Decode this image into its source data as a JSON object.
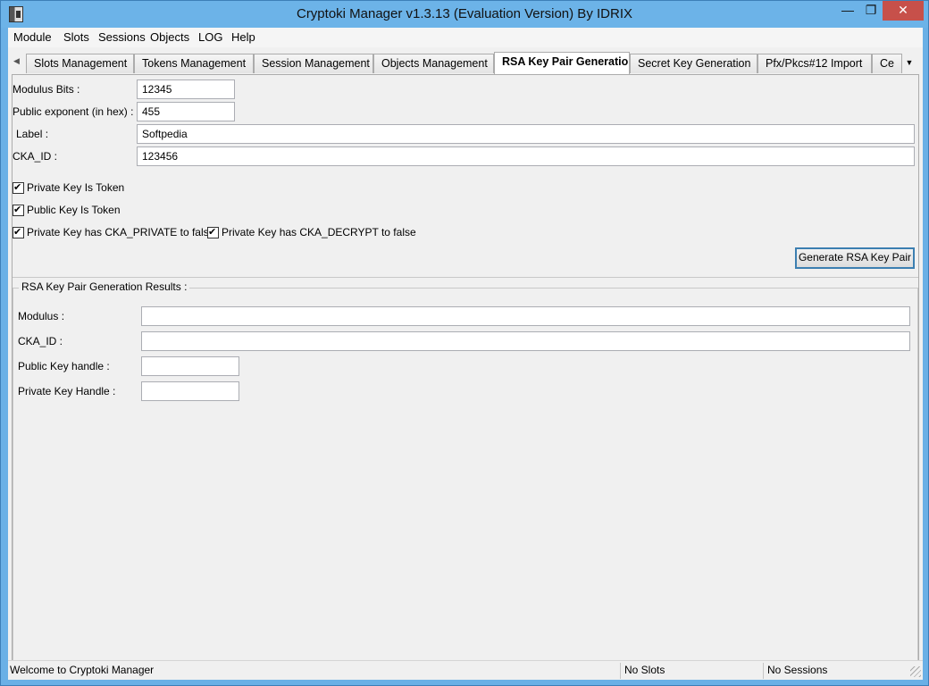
{
  "window": {
    "title": "Cryptoki Manager v1.3.13  (Evaluation Version)  By IDRIX",
    "minimize": "—",
    "maximize": "❐",
    "close": "✕"
  },
  "menu": [
    "Module",
    "Slots",
    "Sessions",
    "Objects",
    "LOG",
    "Help"
  ],
  "tabs": [
    {
      "label": "Slots Management",
      "active": false
    },
    {
      "label": "Tokens Management",
      "active": false
    },
    {
      "label": "Session Management",
      "active": false
    },
    {
      "label": "Objects Management",
      "active": false
    },
    {
      "label": "RSA Key Pair Generation",
      "active": true
    },
    {
      "label": "Secret Key Generation",
      "active": false
    },
    {
      "label": "Pfx/Pkcs#12 Import",
      "active": false
    },
    {
      "label": "Ce",
      "active": false
    }
  ],
  "form": {
    "modulus_bits_label": "Modulus Bits :",
    "modulus_bits_value": "12345",
    "public_exponent_label": "Public exponent (in hex) :",
    "public_exponent_value": "455",
    "label_label": "Label :",
    "label_value": "Softpedia",
    "cka_id_label": "CKA_ID :",
    "cka_id_value": "123456"
  },
  "checkboxes": {
    "private_key_token": {
      "label": "Private Key Is Token",
      "checked": true
    },
    "public_key_token": {
      "label": "Public Key Is Token",
      "checked": true
    },
    "private_false": {
      "label": "Private Key has CKA_PRIVATE to false",
      "checked": true
    },
    "decrypt_false": {
      "label": "Private Key has CKA_DECRYPT to false",
      "checked": true
    }
  },
  "generate_button": "Generate RSA Key Pair",
  "results": {
    "title": "RSA Key Pair Generation Results :",
    "modulus_label": "Modulus :",
    "modulus_value": "",
    "cka_id_label": "CKA_ID :",
    "cka_id_value": "",
    "public_handle_label": "Public Key handle :",
    "public_handle_value": "",
    "private_handle_label": "Private Key Handle :",
    "private_handle_value": ""
  },
  "statusbar": {
    "message": "Welcome to Cryptoki Manager",
    "slots": "No Slots",
    "sessions": "No Sessions"
  }
}
